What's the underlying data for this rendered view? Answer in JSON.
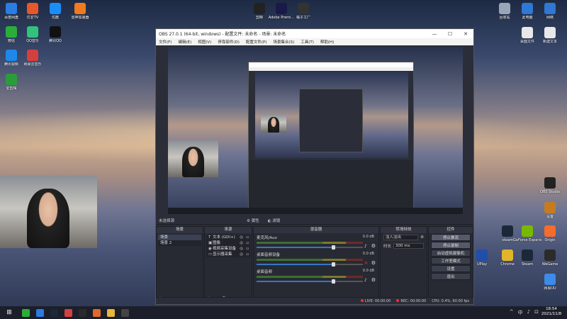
{
  "desktop": {
    "left_icons": [
      {
        "label": "百度网盘",
        "icon": "cloud-icon",
        "color": "#2a7de1"
      },
      {
        "label": "优爱TV",
        "icon": "tv-icon",
        "color": "#e8572a"
      },
      {
        "label": "优酷",
        "icon": "youku-icon",
        "color": "#1b8ef5"
      },
      {
        "label": "雷神加速器",
        "icon": "thunder-icon",
        "color": "#f07a1f"
      },
      {
        "label": "微信",
        "icon": "wechat-icon",
        "color": "#2aae3a"
      },
      {
        "label": "QQ音乐",
        "icon": "music-icon",
        "color": "#31c27c"
      },
      {
        "label": "腾讯QQ",
        "icon": "qq-icon",
        "color": "#111111"
      },
      {
        "label": "腾讯视频",
        "icon": "video-icon",
        "color": "#1d88e8"
      },
      {
        "label": "网易云音乐",
        "icon": "netease-icon",
        "color": "#d53f3f"
      },
      {
        "label": "爱剪辑",
        "icon": "editor-icon",
        "color": "#2a9d3a"
      }
    ],
    "top_icons": [
      {
        "label": "剪映",
        "icon": "jianying-icon",
        "color": "#222222"
      },
      {
        "label": "Adobe Premi...",
        "icon": "premiere-icon",
        "color": "#1a1a4a"
      },
      {
        "label": "橘子工厂",
        "icon": "obs-icon",
        "color": "#333333"
      }
    ],
    "right_icons": [
      {
        "label": "回收站",
        "icon": "recycle-bin-icon",
        "color": "#9aa6b8"
      },
      {
        "label": "此电脑",
        "icon": "computer-icon",
        "color": "#2f78d4"
      },
      {
        "label": "网络",
        "icon": "network-icon",
        "color": "#2f78d4"
      },
      {
        "label": "桌面文件",
        "icon": "file-icon",
        "color": "#e8e8e8"
      },
      {
        "label": "新建文本",
        "icon": "text-file-icon",
        "color": "#e8e8e8"
      },
      {
        "label": "OBS Studio",
        "icon": "obs-icon",
        "color": "#222222"
      },
      {
        "label": "设置",
        "icon": "gear-icon",
        "color": "#c77a1e"
      },
      {
        "label": "steam",
        "icon": "steam-icon",
        "color": "#1b2838"
      },
      {
        "label": "GeForce Experience",
        "icon": "nvidia-icon",
        "color": "#76b900"
      },
      {
        "label": "Origin",
        "icon": "origin-icon",
        "color": "#f56c2d"
      },
      {
        "label": "UPlay",
        "icon": "uplay-icon",
        "color": "#1f4fa8"
      },
      {
        "label": "Chrome",
        "icon": "chrome-icon",
        "color": "#e0b52a"
      },
      {
        "label": "Steam",
        "icon": "steam-icon",
        "color": "#1b2838"
      },
      {
        "label": "WeGame",
        "icon": "wegame-icon",
        "color": "#2b2b2b"
      },
      {
        "label": "网易UU",
        "icon": "uu-icon",
        "color": "#3c8be8"
      }
    ]
  },
  "obs": {
    "title": "OBS 27.0.1 (64-bit, windows) - 配置文件: 未命名 - 场景: 未命名",
    "menu": [
      "文件(F)",
      "编辑(E)",
      "视图(V)",
      "停靠部件(D)",
      "配置文件(P)",
      "场景集合(S)",
      "工具(T)",
      "帮助(H)"
    ],
    "status_label": "未选择源",
    "props_label": "属性",
    "filters_label": "滤镜",
    "docks": {
      "scenes": {
        "header": "场景",
        "items": [
          "场景",
          "场景 2"
        ]
      },
      "sources": {
        "header": "来源",
        "items": [
          {
            "label": "文本 (GDI+)",
            "icon": "text-icon"
          },
          {
            "label": "图像",
            "icon": "image-icon"
          },
          {
            "label": "视频采集设备",
            "icon": "camera-icon"
          },
          {
            "label": "显示器采集",
            "icon": "monitor-icon"
          }
        ]
      },
      "mixer": {
        "header": "混音器",
        "tracks": [
          {
            "name": "麦克风/Aux",
            "db": "0.0 dB",
            "volume": 0.72,
            "muted": false
          },
          {
            "name": "桌面音频设备",
            "db": "0.0 dB",
            "volume": 0.72,
            "muted": true
          },
          {
            "name": "桌面音频",
            "db": "0.0 dB",
            "volume": 0.72,
            "muted": false
          }
        ]
      },
      "transitions": {
        "header": "转场特效",
        "type": "淡入淡出",
        "duration_label": "时长",
        "duration": "300 ms"
      },
      "controls": {
        "header": "控件",
        "buttons": [
          "停止推流",
          "停止录制",
          "启动虚拟摄像机",
          "工作室模式",
          "设置",
          "退出"
        ]
      }
    },
    "statusbar": {
      "live": "LIVE: 00:00:00",
      "rec": "REC: 00:00:00",
      "cpu": "CPU: 0.4%, 60.00 fps"
    }
  },
  "taskbar": {
    "start_icon": "windows-icon",
    "apps": [
      {
        "icon": "wechat-icon",
        "color": "#2aae3a"
      },
      {
        "icon": "edge-icon",
        "color": "#2d7be0"
      },
      {
        "icon": "steam-icon",
        "color": "#1b2838"
      },
      {
        "icon": "netease-icon",
        "color": "#d53f3f"
      },
      {
        "icon": "qq-icon",
        "color": "#2a2a2a"
      },
      {
        "icon": "game-icon",
        "color": "#e06a2a"
      },
      {
        "icon": "folder-icon",
        "color": "#e8b63a"
      },
      {
        "icon": "obs-icon",
        "color": "#444444"
      }
    ],
    "tray": [
      "^",
      "中",
      "♪",
      "⊡"
    ],
    "time": "18:54",
    "date": "2021/11/8"
  }
}
